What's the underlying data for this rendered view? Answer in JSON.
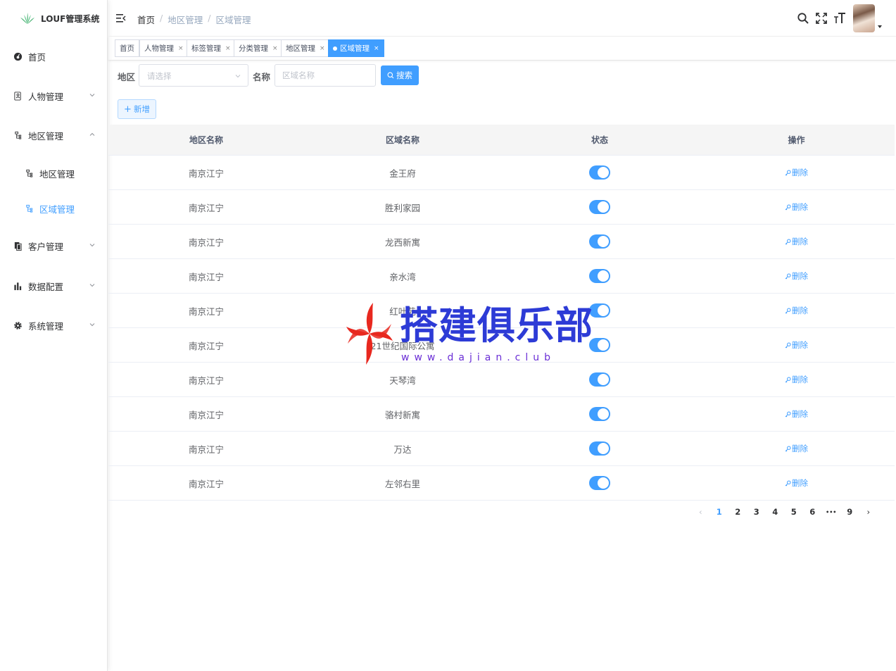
{
  "app": {
    "logo_text": "LOUF管理系统"
  },
  "sidebar": {
    "items": [
      {
        "label": "首页",
        "icon": "dashboard-icon"
      },
      {
        "label": "人物管理",
        "icon": "person-doc-icon"
      },
      {
        "label": "地区管理",
        "icon": "tree-icon",
        "expanded": true
      },
      {
        "label": "地区管理",
        "icon": "tree-icon",
        "sub": true
      },
      {
        "label": "区域管理",
        "icon": "tree-icon",
        "sub": true,
        "active": true
      },
      {
        "label": "客户管理",
        "icon": "copy-icon"
      },
      {
        "label": "数据配置",
        "icon": "bar-chart-icon"
      },
      {
        "label": "系统管理",
        "icon": "gear-icon"
      }
    ]
  },
  "header": {
    "breadcrumb": [
      "首页",
      "地区管理",
      "区域管理"
    ],
    "breadcrumb_sep": "/"
  },
  "tags": [
    {
      "label": "首页",
      "closable": false
    },
    {
      "label": "人物管理",
      "closable": true
    },
    {
      "label": "标签管理",
      "closable": true
    },
    {
      "label": "分类管理",
      "closable": true
    },
    {
      "label": "地区管理",
      "closable": true
    },
    {
      "label": "区域管理",
      "closable": true,
      "active": true
    }
  ],
  "tag_close": "×",
  "filter": {
    "region_label": "地区",
    "region_placeholder": "请选择",
    "name_label": "名称",
    "name_placeholder": "区域名称",
    "search_label": "搜索"
  },
  "add_button": {
    "plus": "+",
    "label": "新增"
  },
  "table": {
    "headers": [
      "地区名称",
      "区域名称",
      "状态",
      "操作"
    ],
    "rows": [
      {
        "region": "南京江宁",
        "area": "金王府",
        "status": true,
        "op": "删除"
      },
      {
        "region": "南京江宁",
        "area": "胜利家园",
        "status": true,
        "op": "删除"
      },
      {
        "region": "南京江宁",
        "area": "龙西新寓",
        "status": true,
        "op": "删除"
      },
      {
        "region": "南京江宁",
        "area": "亲水湾",
        "status": true,
        "op": "删除"
      },
      {
        "region": "南京江宁",
        "area": "红叶苑",
        "status": true,
        "op": "删除"
      },
      {
        "region": "南京江宁",
        "area": "21世纪国际公寓",
        "status": true,
        "op": "删除"
      },
      {
        "region": "南京江宁",
        "area": "天琴湾",
        "status": true,
        "op": "删除"
      },
      {
        "region": "南京江宁",
        "area": "骆村新寓",
        "status": true,
        "op": "删除"
      },
      {
        "region": "南京江宁",
        "area": "万达",
        "status": true,
        "op": "删除"
      },
      {
        "region": "南京江宁",
        "area": "左邻右里",
        "status": true,
        "op": "删除"
      }
    ]
  },
  "pagination": {
    "prev": "‹",
    "pages": [
      "1",
      "2",
      "3",
      "4",
      "5",
      "6"
    ],
    "ellipsis": "•••",
    "last": "9",
    "next": "›",
    "current": "1"
  },
  "watermark": {
    "title": "搭建俱乐部",
    "url": "www.dajian.club"
  },
  "colors": {
    "primary": "#409eff",
    "watermark_blue": "#2d3bd6",
    "watermark_red": "#e8281f"
  }
}
